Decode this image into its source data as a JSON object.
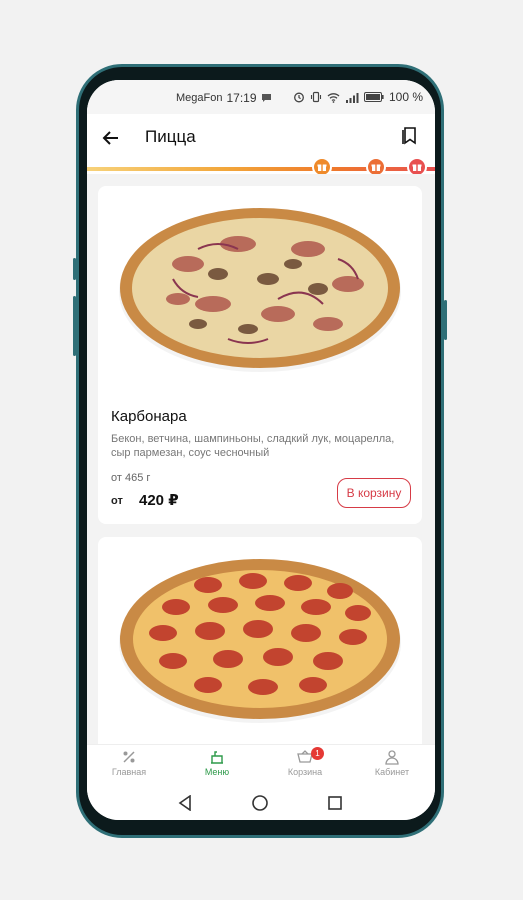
{
  "status": {
    "carrier": "MegaFon",
    "time": "17:19",
    "battery": "100 %"
  },
  "appbar": {
    "title": "Пицца",
    "back_icon": "arrow-left-icon",
    "bookmark_icon": "bookmark-icon"
  },
  "progress": {
    "gift_icon": "gift-icon",
    "gifts": 3
  },
  "products": [
    {
      "name": "Карбонара",
      "description": "Бекон, ветчина, шампиньоны, сладкий лук, моцарелла, сыр пармезан, соус чесночный",
      "weight": "от 465 г",
      "price_prefix": "от",
      "price": "420 ₽",
      "button": "В корзину"
    },
    {
      "name": "",
      "description": ""
    }
  ],
  "nav": {
    "items": [
      {
        "label": "Главная",
        "icon": "percent-icon"
      },
      {
        "label": "Меню",
        "icon": "menu-dish-icon"
      },
      {
        "label": "Корзина",
        "icon": "cart-icon",
        "badge": "1"
      },
      {
        "label": "Кабинет",
        "icon": "user-icon"
      }
    ]
  },
  "colors": {
    "accent_green": "#2e9a4a",
    "cart_button": "#d63b46",
    "badge": "#e53935",
    "progress_start": "#f7d27a",
    "progress_end": "#e85050"
  }
}
